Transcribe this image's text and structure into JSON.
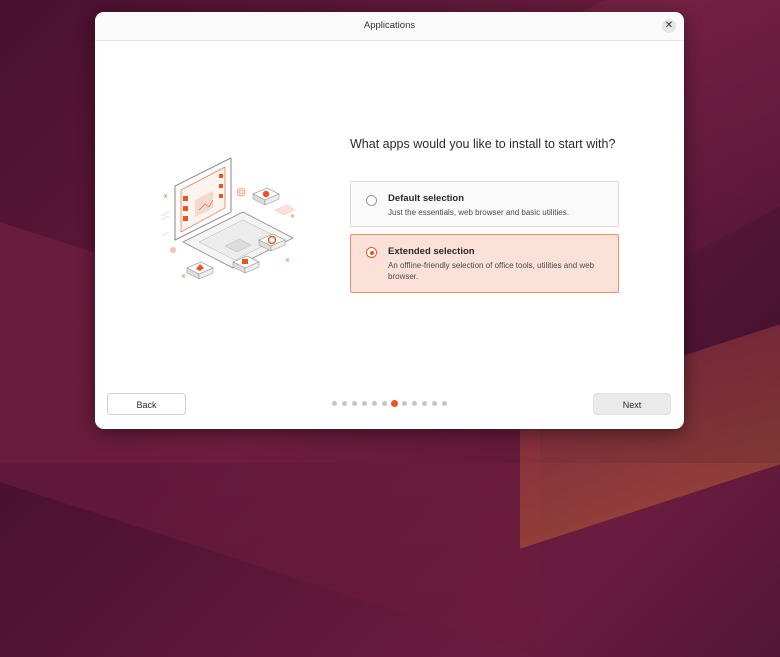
{
  "window": {
    "title": "Applications"
  },
  "question": "What apps would you like to install to start with?",
  "options": [
    {
      "title": "Default selection",
      "description": "Just the essentials, web browser and basic utilities.",
      "selected": false
    },
    {
      "title": "Extended selection",
      "description": "An offline-friendly selection of office tools, utilities and web browser.",
      "selected": true
    }
  ],
  "buttons": {
    "back": "Back",
    "next": "Next",
    "close_icon": "close-icon"
  },
  "progress": {
    "total_steps": 12,
    "current_step": 7
  },
  "colors": {
    "accent": "#e9541f",
    "selected_bg": "#fbe1d8",
    "selected_border": "#e8916d"
  }
}
